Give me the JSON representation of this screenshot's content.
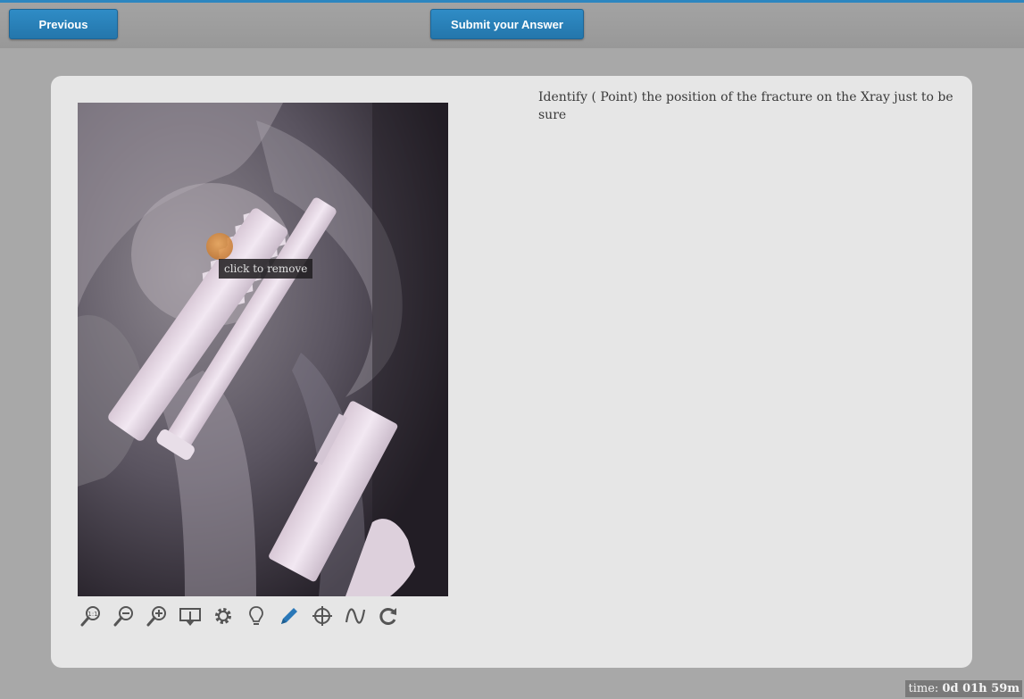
{
  "nav": {
    "previous_label": "Previous",
    "submit_label": "Submit your Answer"
  },
  "question": {
    "text": "Identify ( Point) the position of the fracture on the Xray just to be sure"
  },
  "image": {
    "marker_tooltip": "click to remove"
  },
  "toolbar": {
    "tools": [
      "zoom-reset-icon",
      "zoom-out-icon",
      "zoom-in-icon",
      "fit-screen-icon",
      "settings-gear-icon",
      "hint-lightbulb-icon",
      "pencil-icon",
      "crosshair-icon",
      "wave-icon",
      "rotate-icon"
    ],
    "active_tool": "pencil-icon"
  },
  "timer": {
    "label": "time:",
    "value": "0d 01h 59m"
  },
  "colors": {
    "accent": "#2d86c0",
    "active_tool": "#2a78b8",
    "marker": "#e69a4a"
  }
}
